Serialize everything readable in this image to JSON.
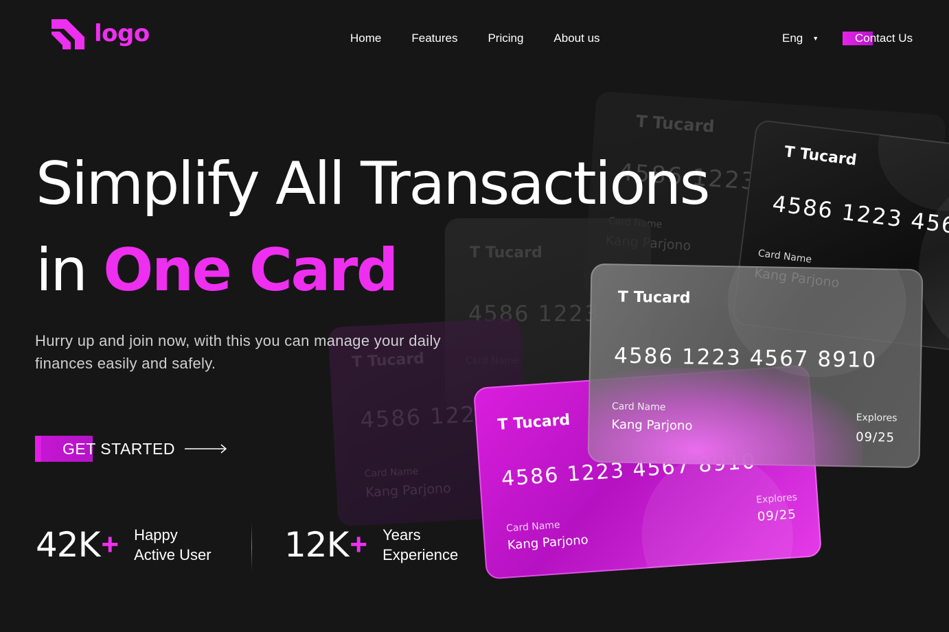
{
  "header": {
    "logo_text": "logo",
    "nav": [
      "Home",
      "Features",
      "Pricing",
      "About us"
    ],
    "language": "Eng",
    "contact_label": "Contact Us"
  },
  "hero": {
    "title_line1": "Simplify All Transactions",
    "title_line2_prefix": "in",
    "title_line2_accent": "One Card",
    "subtitle": "Hurry up and join now, with this you can manage your daily finances easily and safely.",
    "cta_label": "GET STARTED"
  },
  "stats": [
    {
      "value": "42K",
      "plus": "+",
      "label_line1": "Happy",
      "label_line2": "Active User"
    },
    {
      "value": "12K",
      "plus": "+",
      "label_line1": "Years",
      "label_line2": "Experience"
    }
  ],
  "cards": {
    "brand": "Tucard",
    "brand_glyph": "T",
    "number_full": "4586  1223  4567  8910",
    "number_black": "4586  1223  4567  8",
    "number_partial": "4586  1223",
    "number_magenta": "4586  1223  4567  8910",
    "card_name_label": "Card Name",
    "card_name_value": "Kang Parjono",
    "explores_label": "Explores",
    "explores_value": "09/25"
  },
  "colors": {
    "background": "#161616",
    "accent": "#ee2ff0"
  }
}
